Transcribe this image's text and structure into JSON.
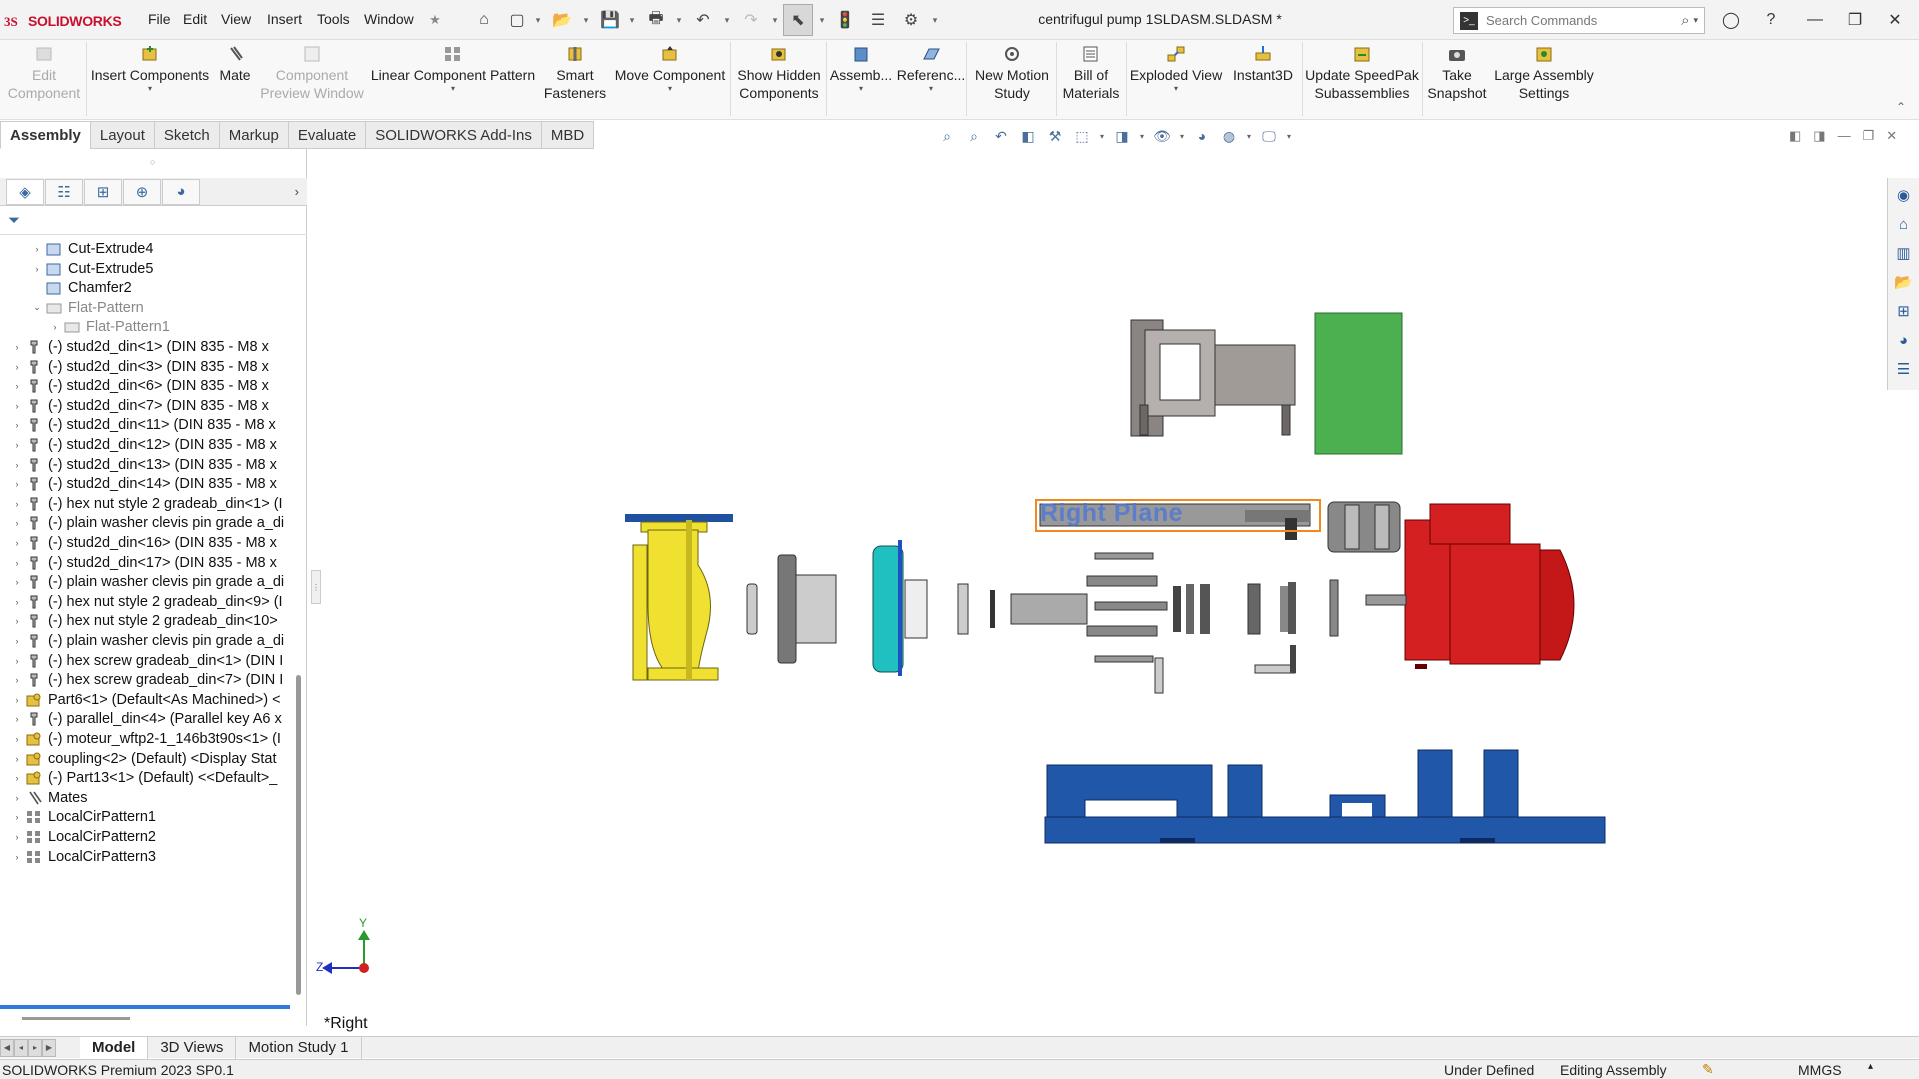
{
  "app": {
    "name": "SOLIDWORKS",
    "document_title": "centrifugul pump 1SLDASM.SLDASM *"
  },
  "menu": [
    "File",
    "Edit",
    "View",
    "Insert",
    "Tools",
    "Window"
  ],
  "search": {
    "placeholder": "Search Commands"
  },
  "commands": [
    {
      "label1": "Edit",
      "label2": "Component",
      "disabled": true
    },
    {
      "label1": "Insert Components",
      "label2": "",
      "disabled": false
    },
    {
      "label1": "Mate",
      "label2": "",
      "disabled": false
    },
    {
      "label1": "Component",
      "label2": "Preview Window",
      "disabled": true
    },
    {
      "label1": "Linear Component Pattern",
      "label2": "",
      "disabled": false
    },
    {
      "label1": "Smart",
      "label2": "Fasteners",
      "disabled": false
    },
    {
      "label1": "Move Component",
      "label2": "",
      "disabled": false
    },
    {
      "label1": "Show Hidden",
      "label2": "Components",
      "disabled": false
    },
    {
      "label1": "Assemb...",
      "label2": "",
      "disabled": false
    },
    {
      "label1": "Referenc...",
      "label2": "",
      "disabled": false
    },
    {
      "label1": "New Motion",
      "label2": "Study",
      "disabled": false
    },
    {
      "label1": "Bill of",
      "label2": "Materials",
      "disabled": false
    },
    {
      "label1": "Exploded View",
      "label2": "",
      "disabled": false
    },
    {
      "label1": "Instant3D",
      "label2": "",
      "disabled": false
    },
    {
      "label1": "Update SpeedPak",
      "label2": "Subassemblies",
      "disabled": false
    },
    {
      "label1": "Take",
      "label2": "Snapshot",
      "disabled": false
    },
    {
      "label1": "Large Assembly",
      "label2": "Settings",
      "disabled": false
    }
  ],
  "tabs": [
    "Assembly",
    "Layout",
    "Sketch",
    "Markup",
    "Evaluate",
    "SOLIDWORKS Add-Ins",
    "MBD"
  ],
  "tree": [
    {
      "label": "Cut-Extrude4",
      "icon": "feature"
    },
    {
      "label": "Cut-Extrude5",
      "icon": "feature"
    },
    {
      "label": "Chamfer2",
      "icon": "feature"
    },
    {
      "label": "Flat-Pattern",
      "icon": "flat"
    },
    {
      "label": "Flat-Pattern1",
      "icon": "flat"
    },
    {
      "label": "(-) stud2d_din<1> (DIN 835 - M8  x",
      "icon": "part"
    },
    {
      "label": "(-) stud2d_din<3> (DIN 835 - M8  x",
      "icon": "part"
    },
    {
      "label": "(-) stud2d_din<6> (DIN 835 - M8  x",
      "icon": "part"
    },
    {
      "label": "(-) stud2d_din<7> (DIN 835 - M8  x",
      "icon": "part"
    },
    {
      "label": "(-) stud2d_din<11> (DIN 835 - M8  x",
      "icon": "part"
    },
    {
      "label": "(-) stud2d_din<12> (DIN 835 - M8  x",
      "icon": "part"
    },
    {
      "label": "(-) stud2d_din<13> (DIN 835 - M8  x",
      "icon": "part"
    },
    {
      "label": "(-) stud2d_din<14> (DIN 835 - M8  x",
      "icon": "part"
    },
    {
      "label": "(-) hex nut style 2 gradeab_din<1> (I",
      "icon": "part"
    },
    {
      "label": "(-) plain washer clevis pin grade a_di",
      "icon": "part"
    },
    {
      "label": "(-) stud2d_din<16> (DIN 835 - M8  x",
      "icon": "part"
    },
    {
      "label": "(-) stud2d_din<17> (DIN 835 - M8  x",
      "icon": "part"
    },
    {
      "label": "(-) plain washer clevis pin grade a_di",
      "icon": "part"
    },
    {
      "label": "(-) hex nut style 2 gradeab_din<9> (I",
      "icon": "part"
    },
    {
      "label": "(-) hex nut style 2 gradeab_din<10>",
      "icon": "part"
    },
    {
      "label": "(-) plain washer clevis pin grade a_di",
      "icon": "part"
    },
    {
      "label": "(-) hex screw gradeab_din<1> (DIN I",
      "icon": "part"
    },
    {
      "label": "(-) hex screw gradeab_din<7> (DIN I",
      "icon": "part"
    },
    {
      "label": "Part6<1> (Default<As Machined>) <",
      "icon": "asm"
    },
    {
      "label": "(-) parallel_din<4> (Parallel key A6 x",
      "icon": "part"
    },
    {
      "label": "(-) moteur_wftp2-1_146b3t90s<1> (I",
      "icon": "asm"
    },
    {
      "label": "coupling<2> (Default) <Display Stat",
      "icon": "asm"
    },
    {
      "label": "(-) Part13<1> (Default) <<Default>_",
      "icon": "asm"
    },
    {
      "label": "Mates",
      "icon": "mates"
    },
    {
      "label": "LocalCirPattern1",
      "icon": "pattern"
    },
    {
      "label": "LocalCirPattern2",
      "icon": "pattern"
    },
    {
      "label": "LocalCirPattern3",
      "icon": "pattern"
    }
  ],
  "graphics": {
    "selected_plane_label": "Right Plane",
    "view_label": "*Right",
    "triad": {
      "y": "Y",
      "z": "Z"
    }
  },
  "bottom_tabs": [
    "Model",
    "3D Views",
    "Motion Study 1"
  ],
  "status": {
    "product": "SOLIDWORKS Premium 2023 SP0.1",
    "state": "Under Defined",
    "mode": "Editing Assembly",
    "units": "MMGS"
  },
  "colors": {
    "accent": "#2f7dd8",
    "selection": "#f08a1c",
    "pump_casing": "#f0e030",
    "impeller": "#20c0c0",
    "motor": "#d42020",
    "baseplate": "#2157a8",
    "guard": "#4caf50"
  }
}
